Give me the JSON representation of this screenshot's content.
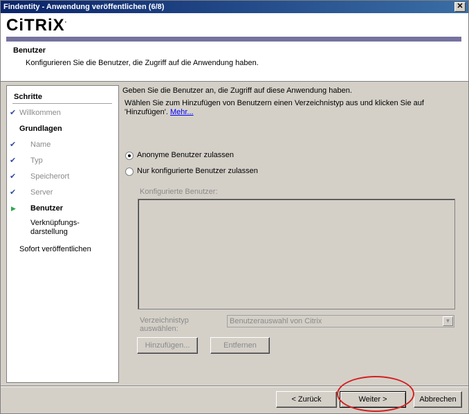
{
  "window": {
    "title": "Findentity - Anwendung veröffentlichen (6/8)",
    "close_glyph": "✕"
  },
  "header": {
    "logo": "CiTRiX",
    "logo_mark": "·",
    "title": "Benutzer",
    "description": "Konfigurieren Sie die Benutzer, die Zugriff auf die Anwendung haben."
  },
  "nav": {
    "heading": "Schritte",
    "items": [
      {
        "label": "Willkommen",
        "state": "done"
      },
      {
        "label": "Grundlagen",
        "state": "group"
      },
      {
        "label": "Name",
        "state": "done"
      },
      {
        "label": "Typ",
        "state": "done"
      },
      {
        "label": "Speicherort",
        "state": "done"
      },
      {
        "label": "Server",
        "state": "done"
      },
      {
        "label": "Benutzer",
        "state": "current"
      },
      {
        "label": "Verknüpfungs-",
        "label2": "darstellung",
        "state": "pending"
      },
      {
        "label": "Sofort veröffentlichen",
        "state": "pending"
      }
    ]
  },
  "content": {
    "intro1": "Geben Sie die Benutzer an, die Zugriff auf diese Anwendung haben.",
    "intro2": "Wählen Sie zum Hinzufügen von Benutzern einen Verzeichnistyp aus und klicken Sie auf 'Hinzufügen'.",
    "more_link": "Mehr...",
    "radio_anonymous": "Anonyme Benutzer zulassen",
    "radio_configured": "Nur konfigurierte Benutzer zulassen",
    "configured_users_label": "Konfigurierte Benutzer:",
    "directory_label_line1": "Verzeichnistyp",
    "directory_label_line2": "auswählen:",
    "directory_value": "Benutzerauswahl von Citrix",
    "add_button": "Hinzufügen...",
    "remove_button": "Entfernen"
  },
  "footer": {
    "back_button": "< Zurück",
    "next_button": "Weiter >",
    "cancel_button": "Abbrechen"
  },
  "colors": {
    "title_bar": "#0a246a",
    "header_bar": "#76729f",
    "check": "#2c4ea0",
    "current_arrow": "#31a54f",
    "highlight": "#d42121"
  },
  "icons": {
    "done": "check-icon",
    "current": "arrow-right-icon"
  }
}
